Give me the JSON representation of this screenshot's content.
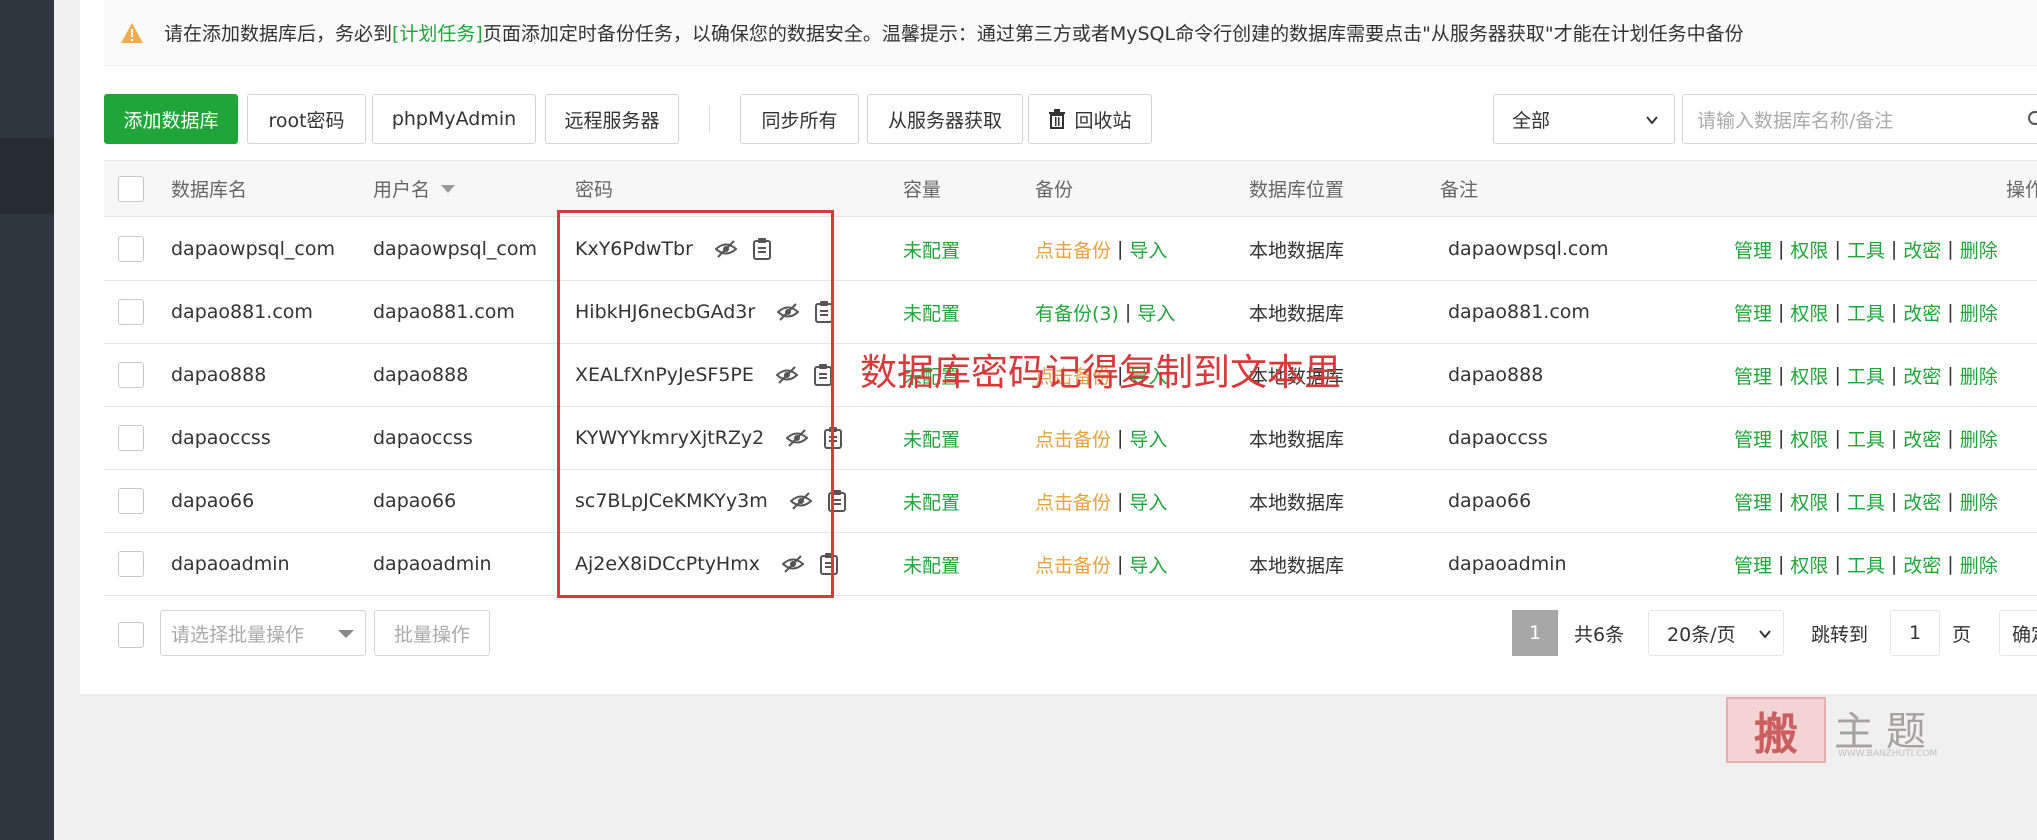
{
  "notice": {
    "prefix": "请在添加数据库后，务必到",
    "link": "[计划任务]",
    "suffix": "页面添加定时备份任务，以确保您的数据安全。温馨提示：通过第三方或者MySQL命令行创建的数据库需要点击\"从服务器获取\"才能在计划任务中备份"
  },
  "toolbar": {
    "add_db": "添加数据库",
    "root_pw": "root密码",
    "phpmyadmin": "phpMyAdmin",
    "remote": "远程服务器",
    "sync_all": "同步所有",
    "fetch_server": "从服务器获取",
    "recycle": "回收站",
    "filter_value": "全部",
    "search_placeholder": "请输入数据库名称/备注"
  },
  "table": {
    "headers": {
      "name": "数据库名",
      "user": "用户名",
      "password": "密码",
      "capacity": "容量",
      "backup": "备份",
      "location": "数据库位置",
      "note": "备注",
      "ops": "操作"
    },
    "rows": [
      {
        "name": "dapaowpsql_com",
        "user": "dapaowpsql_com",
        "password": "KxY6PdwTbr",
        "capacity": "未配置",
        "backup": "点击备份",
        "backup_state": "none",
        "import": "导入",
        "location": "本地数据库",
        "note": "dapaowpsql.com"
      },
      {
        "name": "dapao881.com",
        "user": "dapao881.com",
        "password": "HibkHJ6necbGAd3r",
        "capacity": "未配置",
        "backup": "有备份(3)",
        "backup_state": "has",
        "import": "导入",
        "location": "本地数据库",
        "note": "dapao881.com"
      },
      {
        "name": "dapao888",
        "user": "dapao888",
        "password": "XEALfXnPyJeSF5PE",
        "capacity": "未配置",
        "backup": "点击备份",
        "backup_state": "none",
        "import": "导入",
        "location": "本地数据库",
        "note": "dapao888"
      },
      {
        "name": "dapaoccss",
        "user": "dapaoccss",
        "password": "KYWYYkmryXjtRZy2",
        "capacity": "未配置",
        "backup": "点击备份",
        "backup_state": "none",
        "import": "导入",
        "location": "本地数据库",
        "note": "dapaoccss"
      },
      {
        "name": "dapao66",
        "user": "dapao66",
        "password": "sc7BLpJCeKMKYy3m",
        "capacity": "未配置",
        "backup": "点击备份",
        "backup_state": "none",
        "import": "导入",
        "location": "本地数据库",
        "note": "dapao66"
      },
      {
        "name": "dapaoadmin",
        "user": "dapaoadmin",
        "password": "Aj2eX8iDCcPtyHmx",
        "capacity": "未配置",
        "backup": "点击备份",
        "backup_state": "none",
        "import": "导入",
        "location": "本地数据库",
        "note": "dapaoadmin"
      }
    ],
    "ops": [
      "管理",
      "权限",
      "工具",
      "改密",
      "删除"
    ]
  },
  "annotation": "数据库密码记得复制到文本里",
  "footer": {
    "batch_placeholder": "请选择批量操作",
    "batch_button": "批量操作",
    "current_page": "1",
    "total": "共6条",
    "per_page": "20条/页",
    "jump_label": "跳转到",
    "jump_value": "1",
    "page_unit": "页",
    "confirm": "确定"
  },
  "watermark": {
    "stamp": "搬",
    "text": "主题",
    "url": "WWW.BANZHUTI.COM"
  },
  "colors": {
    "accent": "#20a53a",
    "warning": "#e5a23d",
    "annotation": "#d73a3a",
    "sidebar": "#2f3740"
  }
}
